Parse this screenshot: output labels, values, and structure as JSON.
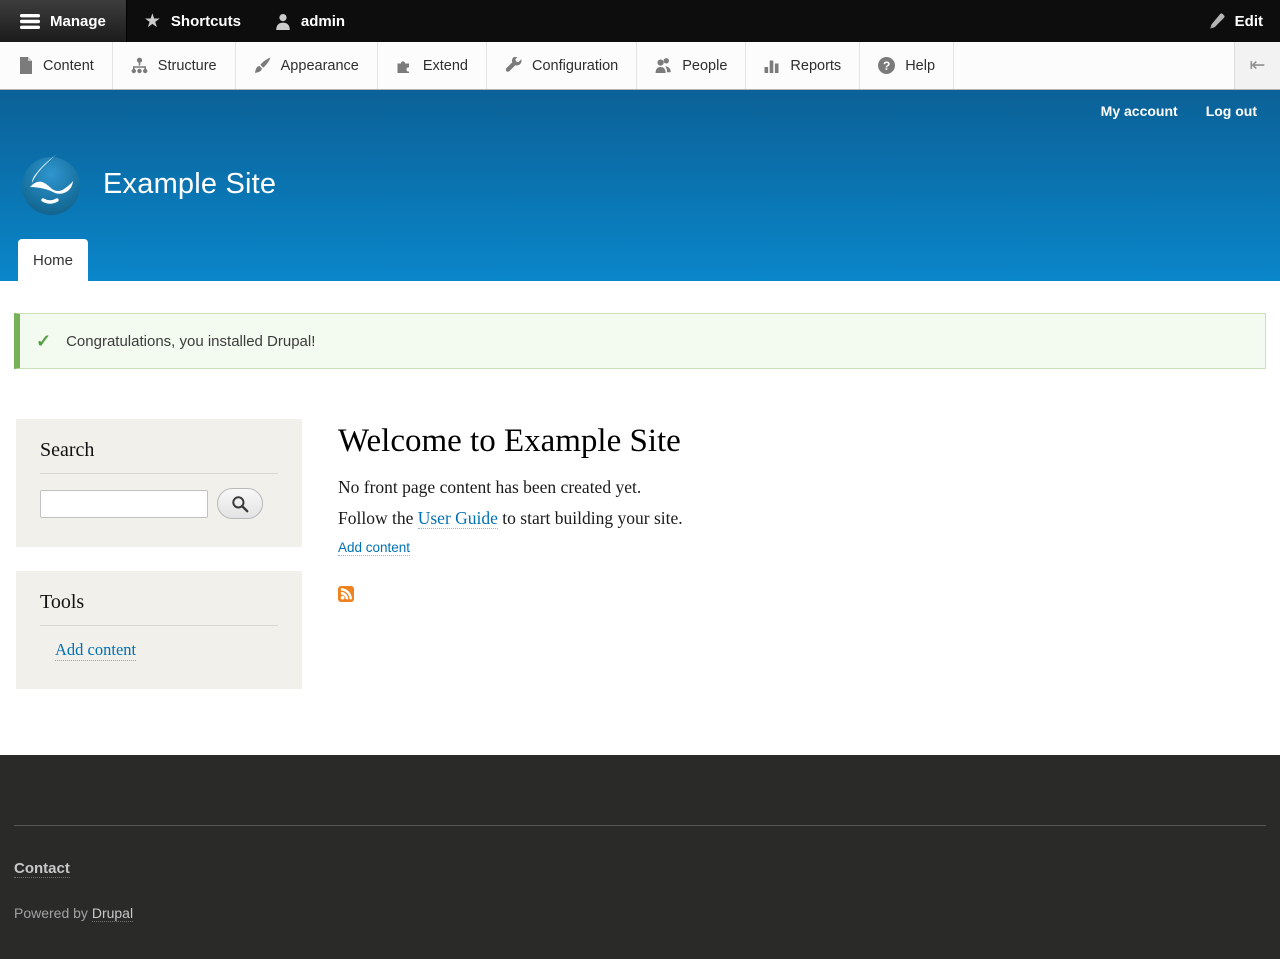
{
  "colors": {
    "header_gradient_top": "#0b6197",
    "header_gradient_bottom": "#0a86ca",
    "link_blue": "#0071b3",
    "message_bg": "#f3faef",
    "message_border": "#77b259",
    "message_check_green": "#55a043",
    "sidebar_block_bg": "#f1f0eb",
    "footer_bg": "#2a2a29",
    "admin_bar_bg": "#0d0d0d",
    "rss_orange": "#ec8220"
  },
  "admin_bar": {
    "manage_label": "Manage",
    "shortcuts_label": "Shortcuts",
    "user_label": "admin",
    "edit_label": "Edit",
    "star_glyph": "★"
  },
  "toolbar": {
    "items": [
      {
        "label": "Content",
        "icon": "file-icon"
      },
      {
        "label": "Structure",
        "icon": "sitemap-icon"
      },
      {
        "label": "Appearance",
        "icon": "paintbrush-icon"
      },
      {
        "label": "Extend",
        "icon": "puzzle-icon"
      },
      {
        "label": "Configuration",
        "icon": "wrench-icon"
      },
      {
        "label": "People",
        "icon": "people-icon"
      },
      {
        "label": "Reports",
        "icon": "bar-chart-icon"
      },
      {
        "label": "Help",
        "icon": "question-icon"
      }
    ],
    "collapse_icon": "orientation-toggle-icon"
  },
  "header": {
    "site_name": "Example Site",
    "my_account_label": "My account",
    "log_out_label": "Log out",
    "home_tab_label": "Home"
  },
  "message": {
    "text": "Congratulations, you installed Drupal!"
  },
  "sidebar": {
    "search_title": "Search",
    "search_placeholder": "",
    "tools_title": "Tools",
    "add_content_label": "Add content"
  },
  "main": {
    "title": "Welcome to Example Site",
    "para1": "No front page content has been created yet.",
    "para2_prefix": "Follow the ",
    "para2_link": "User Guide",
    "para2_suffix": " to start building your site.",
    "add_content_label": "Add content"
  },
  "footer": {
    "contact_label": "Contact",
    "powered_prefix": "Powered by ",
    "powered_link_label": "Drupal"
  }
}
